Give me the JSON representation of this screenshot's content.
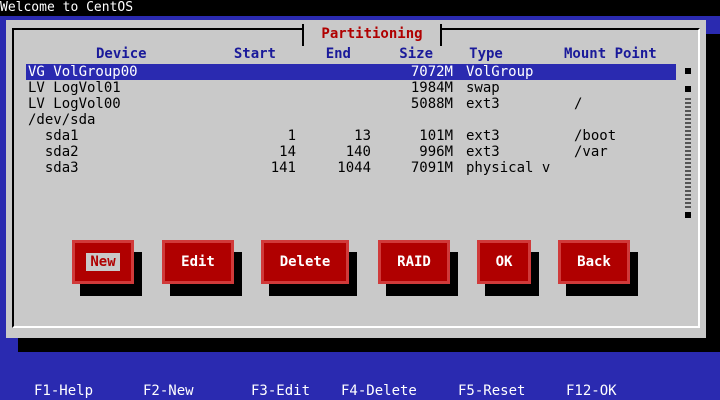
{
  "topbar": {
    "title": "Welcome to CentOS"
  },
  "dialog": {
    "title": "Partitioning"
  },
  "columns": {
    "device": "Device",
    "start": "Start",
    "end": "End",
    "size": "Size",
    "type": "Type",
    "mount": "Mount Point"
  },
  "rows": [
    {
      "device": "VG VolGroup00",
      "start": "",
      "end": "",
      "size": "7072M",
      "type": "VolGroup",
      "mount": "",
      "selected": true
    },
    {
      "device": "LV LogVol01",
      "start": "",
      "end": "",
      "size": "1984M",
      "type": "swap",
      "mount": ""
    },
    {
      "device": "LV LogVol00",
      "start": "",
      "end": "",
      "size": "5088M",
      "type": "ext3",
      "mount": "/"
    },
    {
      "device": "/dev/sda",
      "start": "",
      "end": "",
      "size": "",
      "type": "",
      "mount": ""
    },
    {
      "device": "  sda1",
      "start": "1",
      "end": "13",
      "size": "101M",
      "type": "ext3",
      "mount": "/boot"
    },
    {
      "device": "  sda2",
      "start": "14",
      "end": "140",
      "size": "996M",
      "type": "ext3",
      "mount": "/var"
    },
    {
      "device": "  sda3",
      "start": "141",
      "end": "1044",
      "size": "7091M",
      "type": "physical v",
      "mount": ""
    }
  ],
  "buttons": {
    "new": "New",
    "edit": "Edit",
    "delete": "Delete",
    "raid": "RAID",
    "ok": "OK",
    "back": "Back"
  },
  "footer": {
    "f1": "F1-Help",
    "f2": "F2-New",
    "f3": "F3-Edit",
    "f4": "F4-Delete",
    "f5": "F5-Reset",
    "f12": "F12-OK"
  },
  "colors": {
    "background": "#2a2ab0",
    "dialog": "#c9c9c9",
    "button": "#b00000",
    "title": "#b00000"
  }
}
